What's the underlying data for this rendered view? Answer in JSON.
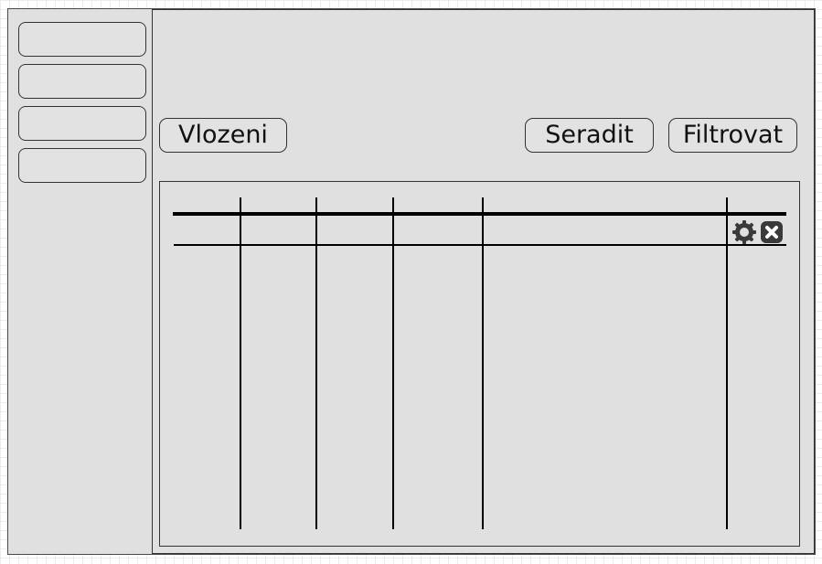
{
  "toolbar": {
    "insert_label": "Vlozeni",
    "sort_label": "Seradit",
    "filter_label": "Filtrovat"
  },
  "sidebar": {
    "items": [
      {
        "label": ""
      },
      {
        "label": ""
      },
      {
        "label": ""
      },
      {
        "label": ""
      }
    ]
  },
  "table": {
    "columns": [
      "",
      "",
      "",
      "",
      "",
      ""
    ],
    "row_actions": [
      "gear-icon",
      "close-icon"
    ]
  }
}
